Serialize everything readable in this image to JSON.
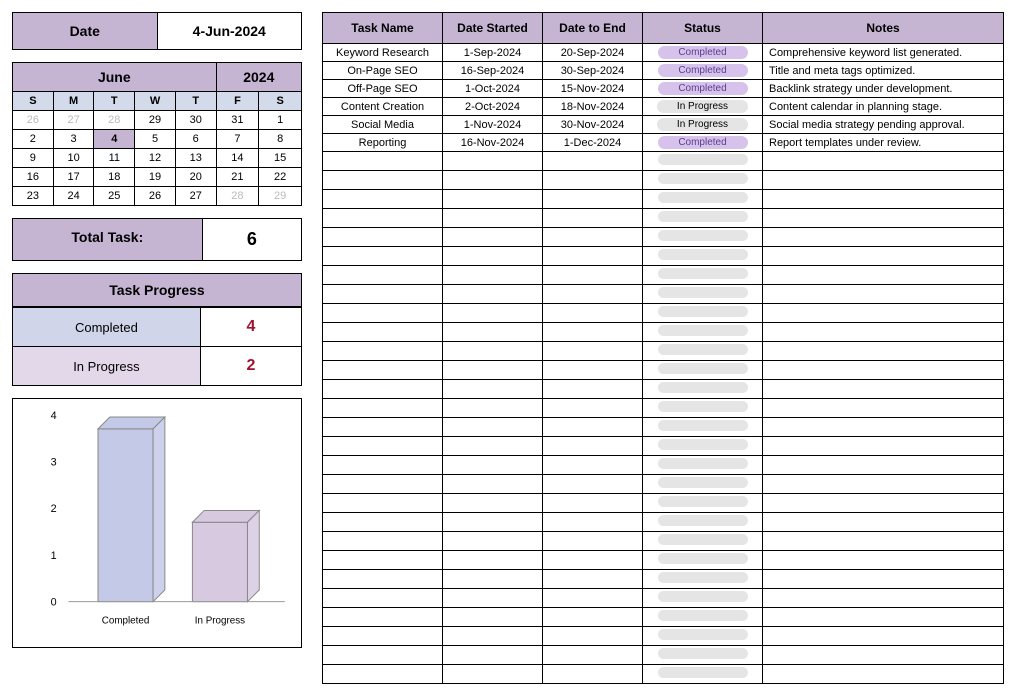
{
  "date_box": {
    "label": "Date",
    "value": "4-Jun-2024"
  },
  "calendar": {
    "month": "June",
    "year": "2024",
    "dow": [
      "S",
      "M",
      "T",
      "W",
      "T",
      "F",
      "S"
    ],
    "weeks": [
      [
        {
          "d": "26",
          "g": true
        },
        {
          "d": "27",
          "g": true
        },
        {
          "d": "28",
          "g": true
        },
        {
          "d": "29"
        },
        {
          "d": "30"
        },
        {
          "d": "31"
        },
        {
          "d": "1"
        }
      ],
      [
        {
          "d": "2"
        },
        {
          "d": "3"
        },
        {
          "d": "4",
          "today": true
        },
        {
          "d": "5"
        },
        {
          "d": "6"
        },
        {
          "d": "7"
        },
        {
          "d": "8"
        }
      ],
      [
        {
          "d": "9"
        },
        {
          "d": "10"
        },
        {
          "d": "11"
        },
        {
          "d": "12"
        },
        {
          "d": "13"
        },
        {
          "d": "14"
        },
        {
          "d": "15"
        }
      ],
      [
        {
          "d": "16"
        },
        {
          "d": "17"
        },
        {
          "d": "18"
        },
        {
          "d": "19"
        },
        {
          "d": "20"
        },
        {
          "d": "21"
        },
        {
          "d": "22"
        }
      ],
      [
        {
          "d": "23"
        },
        {
          "d": "24"
        },
        {
          "d": "25"
        },
        {
          "d": "26"
        },
        {
          "d": "27"
        },
        {
          "d": "28",
          "g": true
        },
        {
          "d": "29",
          "g": true
        }
      ]
    ]
  },
  "total_task": {
    "label": "Total Task:",
    "value": "6"
  },
  "progress": {
    "header": "Task Progress",
    "rows": [
      {
        "label": "Completed",
        "value": "4",
        "cls": "plabel1"
      },
      {
        "label": "In Progress",
        "value": "2",
        "cls": "plabel2"
      }
    ]
  },
  "chart_data": {
    "type": "bar",
    "categories": [
      "Completed",
      "In Progress"
    ],
    "values": [
      3.7,
      1.7
    ],
    "colors": [
      "#c5c9e8",
      "#d7c9e0"
    ],
    "ylabel": "",
    "xlabel": "",
    "ylim": [
      0,
      4
    ],
    "yticks": [
      0,
      1,
      2,
      3,
      4
    ]
  },
  "tasks": {
    "headers": [
      "Task Name",
      "Date Started",
      "Date to End",
      "Status",
      "Notes"
    ],
    "rows": [
      {
        "name": "Keyword Research",
        "start": "1-Sep-2024",
        "end": "20-Sep-2024",
        "status": "Completed",
        "status_type": "completed",
        "notes": "Comprehensive keyword list generated."
      },
      {
        "name": "On-Page SEO",
        "start": "16-Sep-2024",
        "end": "30-Sep-2024",
        "status": "Completed",
        "status_type": "completed",
        "notes": "Title and meta tags optimized."
      },
      {
        "name": "Off-Page SEO",
        "start": "1-Oct-2024",
        "end": "15-Nov-2024",
        "status": "Completed",
        "status_type": "completed",
        "notes": "Backlink strategy under development."
      },
      {
        "name": "Content Creation",
        "start": "2-Oct-2024",
        "end": "18-Nov-2024",
        "status": "In Progress",
        "status_type": "inprogress",
        "notes": "Content calendar in planning stage."
      },
      {
        "name": "Social Media",
        "start": "1-Nov-2024",
        "end": "30-Nov-2024",
        "status": "In Progress",
        "status_type": "inprogress",
        "notes": "Social media strategy pending approval."
      },
      {
        "name": "Reporting",
        "start": "16-Nov-2024",
        "end": "1-Dec-2024",
        "status": "Completed",
        "status_type": "completed",
        "notes": "Report templates under review."
      }
    ],
    "empty_rows": 28
  }
}
